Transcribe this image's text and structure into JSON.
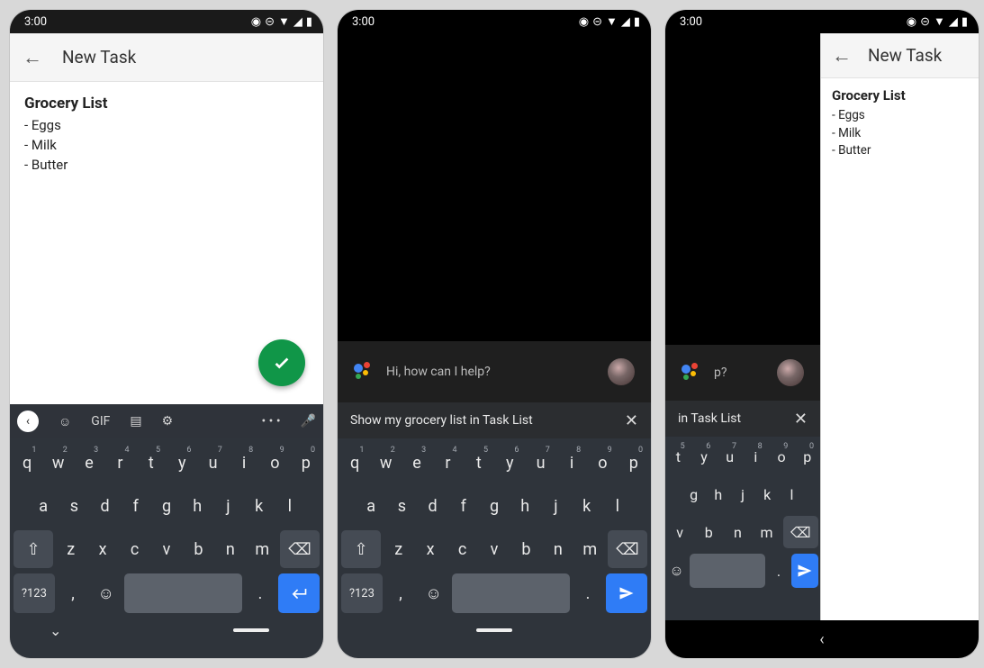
{
  "status": {
    "time": "3:00",
    "icons": [
      "◑",
      "⊝",
      "▾",
      "◢",
      "▮"
    ]
  },
  "screen1": {
    "appbar_title": "New Task",
    "note_title": "Grocery List",
    "items": [
      "- Eggs",
      "- Milk",
      "- Butter"
    ],
    "kb_toolbar": {
      "gif": "GIF",
      "more": "• • •"
    }
  },
  "assistant": {
    "greeting": "Hi, how can I help?",
    "query": "Show my grocery list in Task List",
    "query_clipped": "in Task List"
  },
  "keyboard": {
    "row1": [
      "q",
      "w",
      "e",
      "r",
      "t",
      "y",
      "u",
      "i",
      "o",
      "p"
    ],
    "row1_sup": [
      "1",
      "2",
      "3",
      "4",
      "5",
      "6",
      "7",
      "8",
      "9",
      "0"
    ],
    "row2": [
      "a",
      "s",
      "d",
      "f",
      "g",
      "h",
      "j",
      "k",
      "l"
    ],
    "row3": [
      "z",
      "x",
      "c",
      "v",
      "b",
      "n",
      "m"
    ],
    "sym": "?123",
    "comma": ",",
    "period": "."
  },
  "screen3": {
    "appbar_title": "New Task",
    "note_title": "Grocery List",
    "items": [
      "- Eggs",
      "- Milk",
      "- Butter"
    ]
  }
}
